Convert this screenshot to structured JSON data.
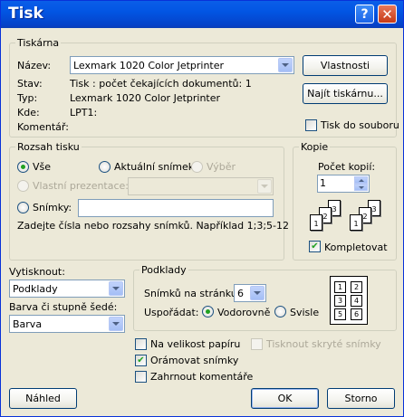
{
  "window": {
    "title": "Tisk"
  },
  "printer": {
    "legend": "Tiskárna",
    "name_label": "Název:",
    "name_value": "Lexmark 1020 Color Jetprinter",
    "properties_button": "Vlastnosti",
    "find_button": "Najít tiskárnu...",
    "status_label": "Stav:",
    "status_value": "Tisk : počet čekajících dokumentů: 1",
    "type_label": "Typ:",
    "type_value": "Lexmark 1020 Color Jetprinter",
    "where_label": "Kde:",
    "where_value": "LPT1:",
    "comment_label": "Komentář:",
    "print_to_file_label": "Tisk do souboru"
  },
  "range": {
    "legend": "Rozsah tisku",
    "all_label": "Vše",
    "current_slide_label": "Aktuální snímek",
    "selection_label": "Výběr",
    "custom_show_label": "Vlastní prezentace:",
    "slides_label": "Snímky:",
    "hint": "Zadejte čísla nebo rozsahy snímků. Například 1;3;5-12"
  },
  "copies": {
    "legend": "Kopie",
    "count_label": "Počet kopií:",
    "count_value": "1",
    "collate_label": "Kompletovat",
    "collate_checked": true,
    "page_numbers": [
      "1",
      "2",
      "3",
      "1",
      "2",
      "3"
    ]
  },
  "print_what": {
    "label": "Vytisknout:",
    "value": "Podklady"
  },
  "color": {
    "label": "Barva či stupně šedé:",
    "value": "Barva"
  },
  "handouts": {
    "legend": "Podklady",
    "slides_per_page_label": "Snímků na stránku:",
    "slides_per_page_value": "6",
    "order_label": "Uspořádat:",
    "horizontal_label": "Vodorovně",
    "vertical_label": "Svisle",
    "preview_numbers": [
      "1",
      "2",
      "3",
      "4",
      "5",
      "6"
    ]
  },
  "options": {
    "scale_to_fit": "Na velikost papíru",
    "frame_slides": "Orámovat snímky",
    "frame_slides_checked": true,
    "include_comments": "Zahrnout komentáře",
    "print_hidden": "Tisknout skryté snímky"
  },
  "buttons": {
    "preview": "Náhled",
    "ok": "OK",
    "cancel": "Storno"
  }
}
